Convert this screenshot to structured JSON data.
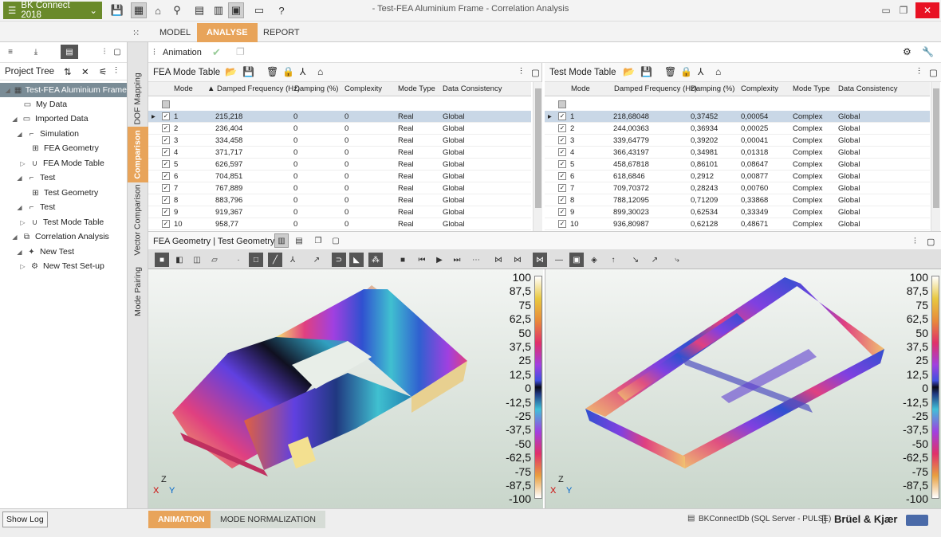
{
  "app_menu": {
    "label": "BK Connect 2018"
  },
  "window_title": "- Test-FEA Aluminium Frame - Correlation Analysis",
  "main_tabs": [
    "MODEL",
    "ANALYSE",
    "REPORT"
  ],
  "left_panel": {
    "title": "Project Tree",
    "items": [
      {
        "label": "Test-FEA Aluminium Frame",
        "icon": "project-icon"
      },
      {
        "label": "My Data",
        "icon": "folder-icon"
      },
      {
        "label": "Imported Data",
        "icon": "folder-icon"
      },
      {
        "label": "Simulation",
        "icon": "simulation-icon"
      },
      {
        "label": "FEA Geometry",
        "icon": "geometry-icon"
      },
      {
        "label": "FEA Mode Table",
        "icon": "mode-table-icon"
      },
      {
        "label": "Test",
        "icon": "test-icon"
      },
      {
        "label": "Test Geometry",
        "icon": "geometry-icon"
      },
      {
        "label": "Test",
        "icon": "test-icon"
      },
      {
        "label": "Test Mode Table",
        "icon": "mode-table-icon"
      },
      {
        "label": "Correlation Analysis",
        "icon": "correlation-icon"
      },
      {
        "label": "New Test",
        "icon": "new-test-icon"
      },
      {
        "label": "New Test Set-up",
        "icon": "setup-icon"
      }
    ]
  },
  "vertical_tabs": [
    "DOF Mapping",
    "Comparison",
    "Vector Comparison",
    "Mode Pairing"
  ],
  "anim_toolbar": {
    "label": "Animation"
  },
  "fea_table": {
    "title": "FEA Mode Table",
    "columns": [
      "Mode",
      "Damped Frequency (Hz)",
      "Damping (%)",
      "Complexity",
      "Mode Type",
      "Data Consistency"
    ],
    "rows": [
      [
        "1",
        "215,218",
        "0",
        "0",
        "Real",
        "Global"
      ],
      [
        "2",
        "236,404",
        "0",
        "0",
        "Real",
        "Global"
      ],
      [
        "3",
        "334,458",
        "0",
        "0",
        "Real",
        "Global"
      ],
      [
        "4",
        "371,717",
        "0",
        "0",
        "Real",
        "Global"
      ],
      [
        "5",
        "626,597",
        "0",
        "0",
        "Real",
        "Global"
      ],
      [
        "6",
        "704,851",
        "0",
        "0",
        "Real",
        "Global"
      ],
      [
        "7",
        "767,889",
        "0",
        "0",
        "Real",
        "Global"
      ],
      [
        "8",
        "883,796",
        "0",
        "0",
        "Real",
        "Global"
      ],
      [
        "9",
        "919,367",
        "0",
        "0",
        "Real",
        "Global"
      ],
      [
        "10",
        "958,77",
        "0",
        "0",
        "Real",
        "Global"
      ]
    ]
  },
  "test_table": {
    "title": "Test Mode Table",
    "columns": [
      "Mode",
      "Damped Frequency (Hz)",
      "Damping (%)",
      "Complexity",
      "Mode Type",
      "Data Consistency"
    ],
    "rows": [
      [
        "1",
        "218,68048",
        "0,37452",
        "0,00054",
        "Complex",
        "Global"
      ],
      [
        "2",
        "244,00363",
        "0,36934",
        "0,00025",
        "Complex",
        "Global"
      ],
      [
        "3",
        "339,64779",
        "0,39202",
        "0,00041",
        "Complex",
        "Global"
      ],
      [
        "4",
        "366,43197",
        "0,34981",
        "0,01318",
        "Complex",
        "Global"
      ],
      [
        "5",
        "458,67818",
        "0,86101",
        "0,08647",
        "Complex",
        "Global"
      ],
      [
        "6",
        "618,6846",
        "0,2912",
        "0,00877",
        "Complex",
        "Global"
      ],
      [
        "7",
        "709,70372",
        "0,28243",
        "0,00760",
        "Complex",
        "Global"
      ],
      [
        "8",
        "788,12095",
        "0,71209",
        "0,33868",
        "Complex",
        "Global"
      ],
      [
        "9",
        "899,30023",
        "0,62534",
        "0,33349",
        "Complex",
        "Global"
      ],
      [
        "10",
        "936,80987",
        "0,62128",
        "0,48671",
        "Complex",
        "Global"
      ]
    ]
  },
  "geometry_panel": {
    "title": "FEA Geometry | Test Geometry"
  },
  "color_scale": [
    "100",
    "87,5",
    "75",
    "62,5",
    "50",
    "37,5",
    "25",
    "12,5",
    "0",
    "-12,5",
    "-25",
    "-37,5",
    "-50",
    "-62,5",
    "-75",
    "-87,5",
    "-100"
  ],
  "axis_labels": {
    "z": "Z",
    "x": "X",
    "y": "Y"
  },
  "bottom": {
    "show_log": "Show Log",
    "tabs": [
      "ANIMATION",
      "MODE NORMALIZATION"
    ],
    "db": "BKConnectDb (SQL Server - PULSE)",
    "brand": "Brüel & Kjær"
  }
}
